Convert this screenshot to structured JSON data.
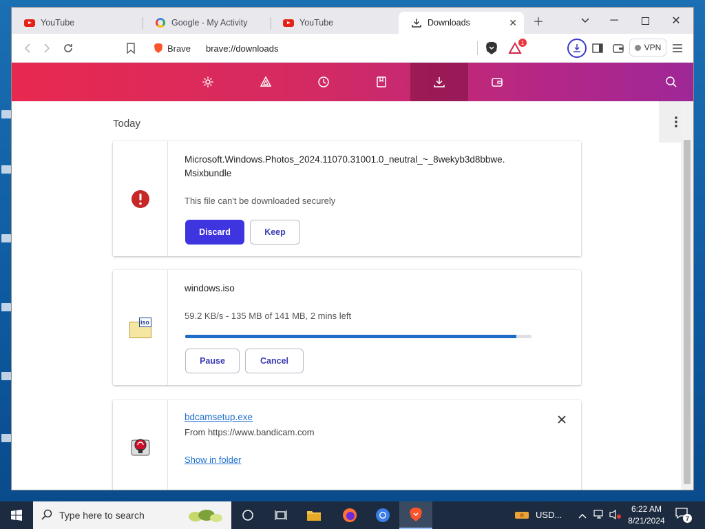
{
  "tabs": [
    {
      "label": "YouTube",
      "favicon": "youtube-icon"
    },
    {
      "label": "Google - My Activity",
      "favicon": "google-icon"
    },
    {
      "label": "YouTube",
      "favicon": "youtube-icon"
    },
    {
      "label": "Downloads",
      "favicon": "download-icon",
      "active": true
    }
  ],
  "omnibox": {
    "shield_label": "Brave",
    "url": "brave://downloads"
  },
  "toolbar": {
    "rewards_badge": "1",
    "vpn_label": "VPN"
  },
  "nav": {
    "items": [
      {
        "icon": "gear-icon"
      },
      {
        "icon": "rewards-triangle-icon"
      },
      {
        "icon": "history-icon"
      },
      {
        "icon": "bookmarks-icon"
      },
      {
        "icon": "download-icon",
        "active": true
      },
      {
        "icon": "wallet-icon"
      }
    ]
  },
  "section_title": "Today",
  "downloads": {
    "item1": {
      "filename_line1": "Microsoft.Windows.Photos_2024.11070.31001.0_neutral_~_8wekyb3d8bbwe.",
      "filename_line2": "Msixbundle",
      "warning": "This file can't be downloaded securely",
      "discard_label": "Discard",
      "keep_label": "Keep"
    },
    "item2": {
      "filename": "windows.iso",
      "icon_label": "iso",
      "status": "59.2 KB/s - 135 MB of 141 MB, 2 mins left",
      "progress": 0.957,
      "pause_label": "Pause",
      "cancel_label": "Cancel"
    },
    "item3": {
      "filename": "bdcamsetup.exe",
      "source": "From https://www.bandicam.com",
      "show_in_folder": "Show in folder"
    }
  },
  "taskbar": {
    "search_placeholder": "Type here to search",
    "currency": "USD...",
    "time": "6:22 AM",
    "date": "8/21/2024",
    "notification_count": "7"
  },
  "colors": {
    "accent": "#3f35e0",
    "nav_gradient_start": "#e8294f",
    "nav_gradient_end": "#9e2797",
    "error": "#c62828",
    "progress": "#1f6cc7"
  }
}
